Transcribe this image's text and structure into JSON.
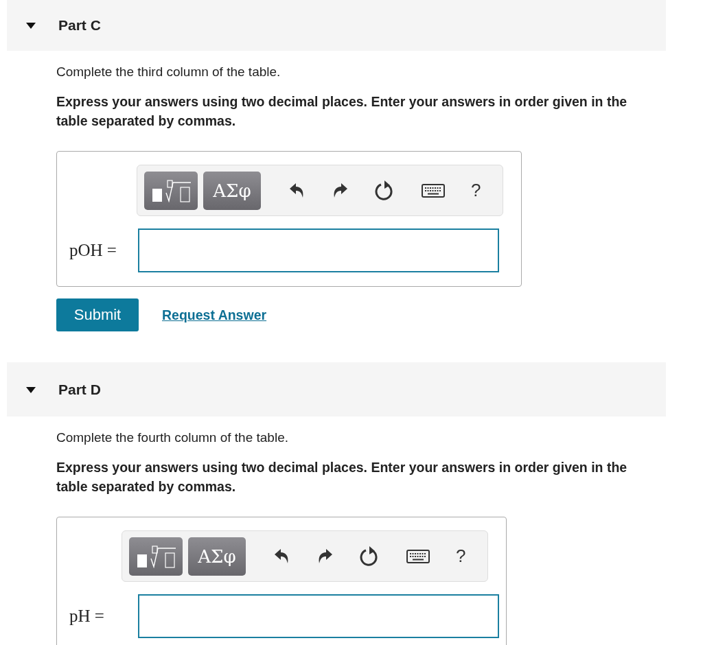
{
  "parts": [
    {
      "title": "Part C",
      "expanded": true,
      "instruction": "Complete the third column of the table.",
      "emphasis": "Express your answers using two decimal places. Enter your answers in order given in the table separated by commas.",
      "toolbar": [
        {
          "kind": "template"
        },
        {
          "kind": "symbols",
          "label": "ΑΣφ"
        },
        {
          "kind": "undo"
        },
        {
          "kind": "redo"
        },
        {
          "kind": "reset"
        },
        {
          "kind": "keyboard"
        },
        {
          "kind": "help",
          "label": "?"
        }
      ],
      "answer_label": "pOH =",
      "actions": [
        {
          "kind": "button",
          "label": "Submit"
        },
        {
          "kind": "link",
          "label": "Request Answer"
        }
      ]
    },
    {
      "title": "Part D",
      "expanded": true,
      "instruction": "Complete the fourth column of the table.",
      "emphasis": "Express your answers using two decimal places. Enter your answers in order given in the table separated by commas.",
      "toolbar": [
        {
          "kind": "template"
        },
        {
          "kind": "symbols",
          "label": "ΑΣφ"
        },
        {
          "kind": "undo"
        },
        {
          "kind": "redo"
        },
        {
          "kind": "reset"
        },
        {
          "kind": "keyboard"
        },
        {
          "kind": "help",
          "label": "?"
        }
      ],
      "answer_label": "pH ="
    }
  ]
}
